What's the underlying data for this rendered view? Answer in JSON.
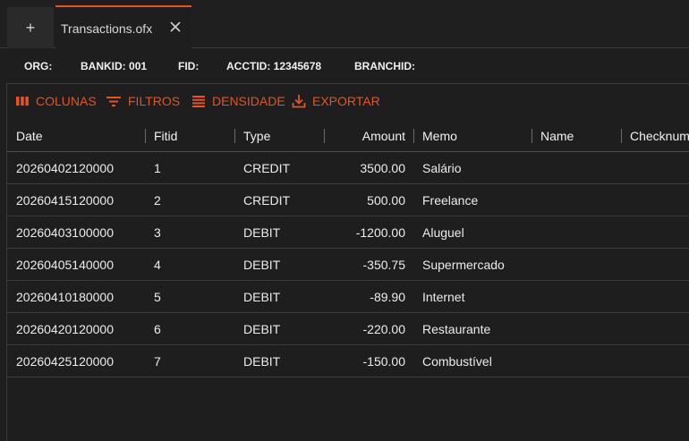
{
  "tabs": {
    "add_label": "+",
    "active": {
      "label": "Transactions.ofx"
    }
  },
  "info": [
    {
      "key": "ORG:",
      "value": ""
    },
    {
      "key": "BANKID:",
      "value": "001"
    },
    {
      "key": "FID:",
      "value": ""
    },
    {
      "key": "ACCTID:",
      "value": "12345678"
    },
    {
      "key": "BRANCHID:",
      "value": ""
    }
  ],
  "toolbar": {
    "columns": "COLUNAS",
    "filters": "FILTROS",
    "density": "DENSIDADE",
    "export": "EXPORTAR"
  },
  "accent_color": "#e8531f",
  "table": {
    "columns": [
      "Date",
      "Fitid",
      "Type",
      "Amount",
      "Memo",
      "Name",
      "Checknum"
    ],
    "rows": [
      [
        "20260402120000",
        "1",
        "CREDIT",
        "3500.00",
        "Salário",
        "",
        ""
      ],
      [
        "20260415120000",
        "2",
        "CREDIT",
        "500.00",
        "Freelance",
        "",
        ""
      ],
      [
        "20260403100000",
        "3",
        "DEBIT",
        "-1200.00",
        "Aluguel",
        "",
        ""
      ],
      [
        "20260405140000",
        "4",
        "DEBIT",
        "-350.75",
        "Supermercado",
        "",
        ""
      ],
      [
        "20260410180000",
        "5",
        "DEBIT",
        "-89.90",
        "Internet",
        "",
        ""
      ],
      [
        "20260420120000",
        "6",
        "DEBIT",
        "-220.00",
        "Restaurante",
        "",
        ""
      ],
      [
        "20260425120000",
        "7",
        "DEBIT",
        "-150.00",
        "Combustível",
        "",
        ""
      ]
    ]
  }
}
